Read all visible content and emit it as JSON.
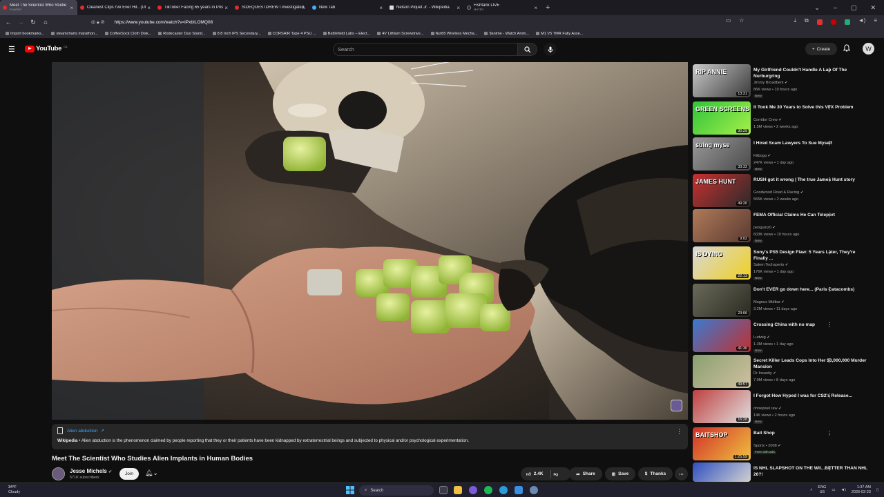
{
  "browser": {
    "tabs": [
      {
        "title": "Meet The Scientist Who Studie",
        "subtitle": "PLAYING",
        "active": true,
        "fav": "red"
      },
      {
        "title": "Cleanest Clips I've Ever Hit.. (Ul",
        "fav": "red"
      },
      {
        "title": "TikToker Facing 65 years in Pris",
        "fav": "red"
      },
      {
        "title": "SIDEQUESTDREW I investigated",
        "fav": "red"
      },
      {
        "title": "New Tab",
        "fav": "blue"
      },
      {
        "title": "Nelson Piquet Jr. - Wikipedia",
        "fav": "w"
      },
      {
        "title": "Fishtank LIVE",
        "subtitle": "MUTED",
        "fav": "dk"
      }
    ],
    "new_tab_icon": "plus-icon",
    "url": "https://www.youtube.com/watch?v=iPxbILOMQ08",
    "bookmarks": [
      "Import bookmarks...",
      "steamcharts marathon...",
      "CoffeeSock Cloth Disk...",
      "Rodecaster Duo Stand...",
      "8.8 Inch IPS Secondary...",
      "CORSAIR Type 4 PSU ...",
      "Battlefield Labs – Elect...",
      "4V Lithium Screwdrive...",
      "Nut65 Wireless Mecha...",
      "9anime - Watch Anim...",
      "M1 V5 TMR Fully Asse..."
    ]
  },
  "youtube": {
    "logo_text": "YouTube",
    "logo_region": "CA",
    "search_placeholder": "Search",
    "create_label": "Create",
    "account_initial": "W"
  },
  "info_panel": {
    "title": "Alien abduction",
    "source": "Wikipedia",
    "text": " • Alien abduction is the phenomenon claimed by people reporting that they or their patients have been kidnapped by extraterrestrial beings and subjected to physical and/or psychological experimentation."
  },
  "video": {
    "title": "Meet The Scientist Who Studies Alien Implants in Human Bodies",
    "channel": "Jesse Michels",
    "subscribers": "571K subscribers",
    "join_label": "Join",
    "likes": "2.4K",
    "share_label": "Share",
    "save_label": "Save",
    "thanks_label": "Thanks"
  },
  "sidebar": [
    {
      "title": "My Girlfriend Couldn't Handle A Lap Of The Nurburgring",
      "channel": "Jimmy Broadbent",
      "meta": "86K views • 10 hours ago",
      "badge": "New",
      "duration": "13:31",
      "thumb_text": "RIP ANNIE",
      "c1": "#c9c9c9",
      "c2": "#3a3a3a"
    },
    {
      "title": "It Took Me 30 Years to Solve this VFX Problem",
      "channel": "Corridor Crew",
      "meta": "1.5M views • 2 weeks ago",
      "badge": "",
      "duration": "30:29",
      "thumb_text": "GREEN SCREENS",
      "c1": "#2fc43a",
      "c2": "#a6f04a"
    },
    {
      "title": "I Hired Scam Lawyers To Sue Myself",
      "channel": "Kitboga",
      "meta": "247K views • 1 day ago",
      "badge": "New",
      "duration": "33:32",
      "thumb_text": "suing myse",
      "c1": "#9a9a9a",
      "c2": "#4a4a4a"
    },
    {
      "title": "RUSH got it wrong | The true James Hunt story",
      "channel": "Goodwood Road & Racing",
      "meta": "565K views • 2 weeks ago",
      "badge": "",
      "duration": "49:20",
      "thumb_text": "JAMES HUNT",
      "c1": "#c93030",
      "c2": "#2a2a2a"
    },
    {
      "title": "FEMA Official Claims He Can Teleport",
      "channel": "penguinz0",
      "meta": "603K views • 10 hours ago",
      "badge": "New",
      "duration": "9:02",
      "thumb_text": "",
      "c1": "#b07a5a",
      "c2": "#5a3a30"
    },
    {
      "title": "Sony's PS5 Design Flaw: 5 Years Later, They're Finally ...",
      "channel": "Salem Techsperts",
      "meta": "176K views • 1 day ago",
      "badge": "New",
      "duration": "22:13",
      "thumb_text": "IS DYING",
      "c1": "#d8d8d8",
      "c2": "#f0d020"
    },
    {
      "title": "Don't EVER go down here... (Paris Catacombs)",
      "channel": "Magnus Midtbø",
      "meta": "3.2M views • 11 days ago",
      "badge": "",
      "duration": "23:06",
      "thumb_text": "",
      "c1": "#6a6a5a",
      "c2": "#2a2a22"
    },
    {
      "title": "Crossing China with no map",
      "channel": "Ludwig",
      "meta": "1.3M views • 1 day ago",
      "badge": "New",
      "duration": "41:30",
      "thumb_text": "",
      "c1": "#3a7ad0",
      "c2": "#c03030"
    },
    {
      "title": "Secret Killer Leads Cops Into Her $3,000,000 Murder Mansion",
      "channel": "Dr Insanity",
      "meta": "7.9M views • 8 days ago",
      "badge": "",
      "duration": "49:57",
      "thumb_text": "",
      "c1": "#8aa070",
      "c2": "#d0c0a0"
    },
    {
      "title": "I Forgot How Hyped I was for CS2's Release...",
      "channel": "ohnepixel raw",
      "meta": "14K views • 2 hours ago",
      "badge": "New",
      "duration": "16:28",
      "thumb_text": "",
      "c1": "#c04040",
      "c2": "#e0e0e0"
    },
    {
      "title": "Bait Shop",
      "channel": "Sports • 2008",
      "meta": "",
      "badge": "Free with ads",
      "duration": "1:25:59",
      "thumb_text": "BAITSHOP",
      "c1": "#d03028",
      "c2": "#f0c040"
    },
    {
      "title": "IS NHL SLAPSHOT ON THE WII...BETTER THAN NHL 26?!",
      "channel": "",
      "meta": "",
      "badge": "",
      "duration": "",
      "thumb_text": "",
      "c1": "#3050c0",
      "c2": "#d0d0d0"
    }
  ],
  "taskbar": {
    "temp": "34°F",
    "weather": "Cloudy",
    "search_label": "Search",
    "lang1": "ENG",
    "lang2": "US",
    "time": "1:37 AM",
    "date": "2026-03-23"
  }
}
